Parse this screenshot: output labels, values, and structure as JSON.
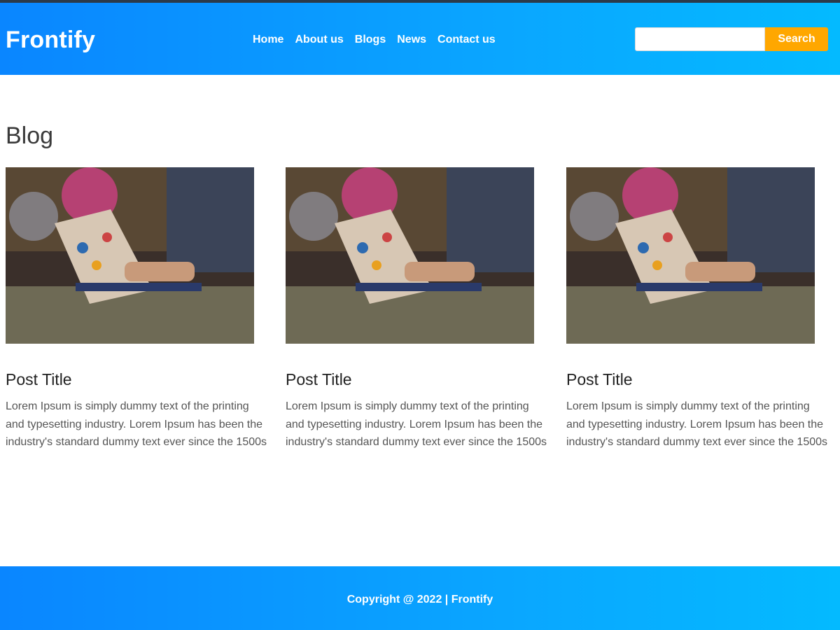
{
  "header": {
    "brand": "Frontify",
    "nav": [
      {
        "label": "Home"
      },
      {
        "label": "About us"
      },
      {
        "label": "Blogs"
      },
      {
        "label": "News"
      },
      {
        "label": "Contact us"
      }
    ],
    "search": {
      "value": "",
      "button_label": "Search"
    }
  },
  "main": {
    "section_title": "Blog",
    "posts": [
      {
        "title": "Post Title",
        "excerpt": "Lorem Ipsum is simply dummy text of the printing and typesetting industry. Lorem Ipsum has been the industry's standard dummy text ever since the 1500s",
        "image": "person-typing-on-laptop-photo"
      },
      {
        "title": "Post Title",
        "excerpt": "Lorem Ipsum is simply dummy text of the printing and typesetting industry. Lorem Ipsum has been the industry's standard dummy text ever since the 1500s",
        "image": "person-typing-on-laptop-photo"
      },
      {
        "title": "Post Title",
        "excerpt": "Lorem Ipsum is simply dummy text of the printing and typesetting industry. Lorem Ipsum has been the industry's standard dummy text ever since the 1500s",
        "image": "person-typing-on-laptop-photo"
      }
    ]
  },
  "footer": {
    "copyright": "Copyright @ 2022 | Frontify"
  },
  "colors": {
    "header_gradient_start": "#0a86ff",
    "header_gradient_end": "#04baff",
    "search_button": "#ffa700"
  }
}
